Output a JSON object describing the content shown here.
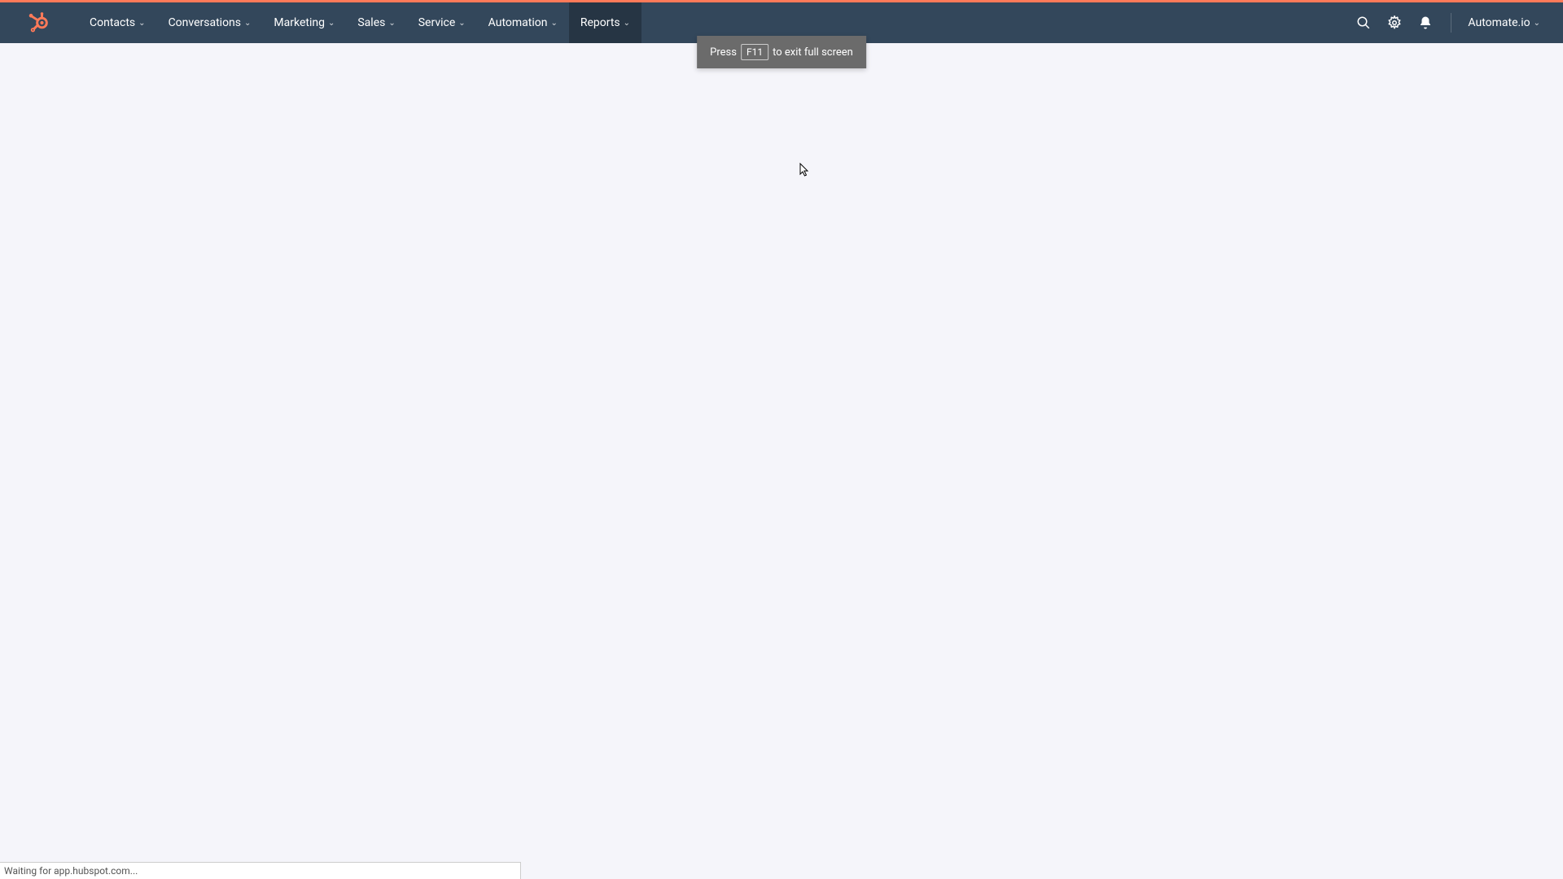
{
  "nav": {
    "items": [
      {
        "label": "Contacts",
        "active": false
      },
      {
        "label": "Conversations",
        "active": false
      },
      {
        "label": "Marketing",
        "active": false
      },
      {
        "label": "Sales",
        "active": false
      },
      {
        "label": "Service",
        "active": false
      },
      {
        "label": "Automation",
        "active": false
      },
      {
        "label": "Reports",
        "active": true
      }
    ]
  },
  "account": {
    "label": "Automate.io"
  },
  "tooltip": {
    "prefix": "Press",
    "key": "F11",
    "suffix": "to exit full screen"
  },
  "status": {
    "text": "Waiting for app.hubspot.com..."
  }
}
